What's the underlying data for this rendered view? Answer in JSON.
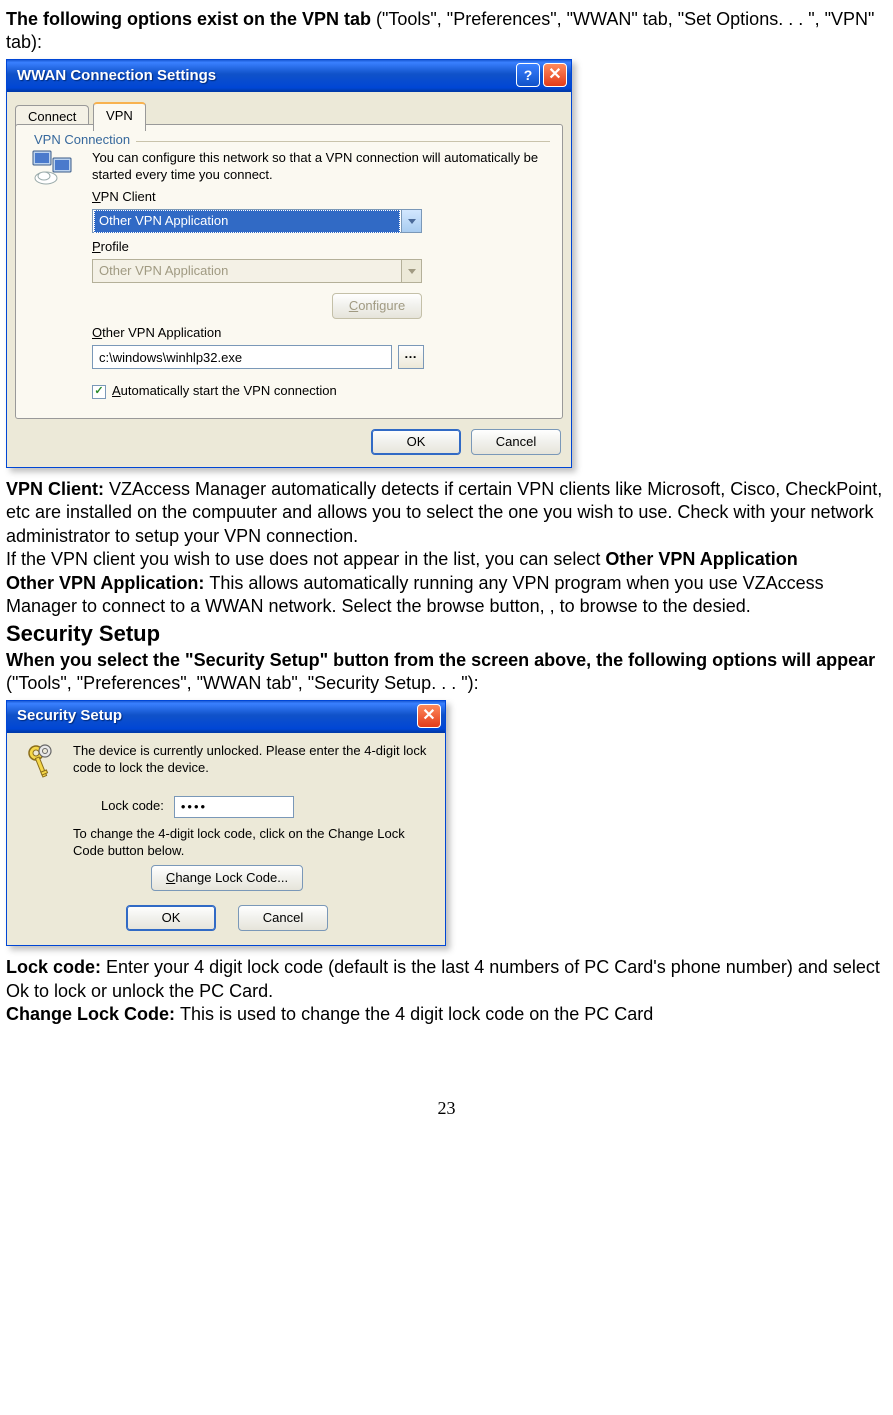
{
  "intro": {
    "bold": "The following options exist on the VPN tab ",
    "rest": "(\"Tools\", \"Preferences\", \"WWAN\" tab, \"Set Options. . . \", \"VPN\" tab):"
  },
  "wwan_dialog": {
    "title": "WWAN Connection Settings",
    "tabs": {
      "connect": "Connect",
      "vpn": "VPN"
    },
    "group_label": "VPN Connection",
    "description": "You can configure this network so that a VPN connection will automatically be started every time you connect.",
    "vpn_client_label": "VPN Client",
    "vpn_client_value": "Other VPN Application",
    "profile_label": "Profile",
    "profile_value": "Other VPN Application",
    "configure_btn": "Configure",
    "other_vpn_label": "Other VPN Application",
    "other_vpn_path": "c:\\windows\\winhlp32.exe",
    "autostart_label": "Automatically start the VPN connection",
    "ok": "OK",
    "cancel": "Cancel"
  },
  "para_vpn_client": {
    "lead": "VPN Client: ",
    "text": "VZAccess Manager automatically detects if certain VPN clients like Microsoft, Cisco, CheckPoint, etc are installed on the compuuter and allows you to select the one you wish to use. Check with your network administrator to setup your VPN connection."
  },
  "para_other_list": {
    "text_part1": "If the VPN client you wish to use does not appear in the list, you can select ",
    "bold_part": "Other VPN Application"
  },
  "para_other_vpn": {
    "lead": "Other VPN Application: ",
    "text": "This allows automatically running any VPN program when you use VZAccess Manager to connect to a WWAN network. Select the browse button, , to browse to the desied."
  },
  "heading_security": "Security Setup",
  "para_sec_intro": {
    "bold": "When you select the \"Security Setup\" button from the screen above, the following options will appear",
    "rest": "(\"Tools\", \"Preferences\", \"WWAN tab\", \"Security Setup. . . \"):"
  },
  "sec_dialog": {
    "title": "Security Setup",
    "line1": "The device is currently unlocked.  Please enter the 4-digit lock code to lock the device.",
    "lock_code_label": "Lock code:",
    "lock_code_value": "••••",
    "line2": "To change the 4-digit lock code, click on the Change Lock Code button below.",
    "change_btn": "Change Lock Code...",
    "ok": "OK",
    "cancel": "Cancel"
  },
  "para_lock_code": {
    "lead": "Lock code: ",
    "text": "Enter your 4 digit lock code (default is the last 4 numbers of PC Card's phone number) and select Ok to lock or unlock the PC Card."
  },
  "para_change_lock": {
    "lead": "Change Lock Code: ",
    "text": "This is used to change the 4 digit lock code on the PC Card"
  },
  "page_number": "23"
}
